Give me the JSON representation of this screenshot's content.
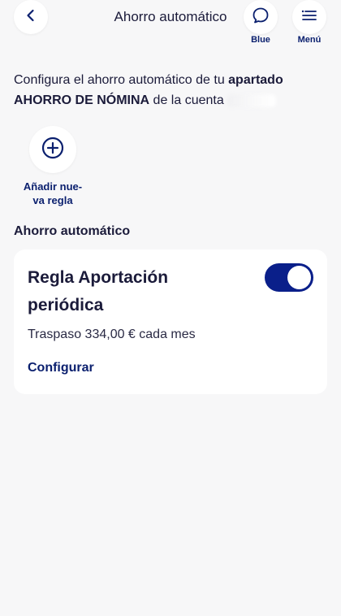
{
  "header": {
    "title": "Ahorro automático",
    "back_icon": "chevron-left-icon",
    "blue_label": "Blue",
    "blue_icon": "chat-bubble-icon",
    "menu_label": "Menú",
    "menu_icon": "hamburger-icon"
  },
  "intro": {
    "text_before": "Configura el ahorro automático de tu ",
    "bold_1": "apartado",
    "bold_2": "AHORRO DE NÓMINA",
    "text_after": " de la cuenta "
  },
  "add_rule": {
    "icon": "plus-circle-icon",
    "label_line1": "Añadir nue-",
    "label_line2": "va regla"
  },
  "section": {
    "title": "Ahorro automático"
  },
  "rule_card": {
    "title_line1": "Regla Aportación",
    "title_line2": "periódica",
    "toggle_on": true,
    "detail": "Traspaso 334,00 € cada mes",
    "configure_label": "Configurar"
  },
  "colors": {
    "accent": "#0a1f8a",
    "text": "#1b1b3a",
    "background": "#f7f7f8",
    "card": "#ffffff"
  }
}
